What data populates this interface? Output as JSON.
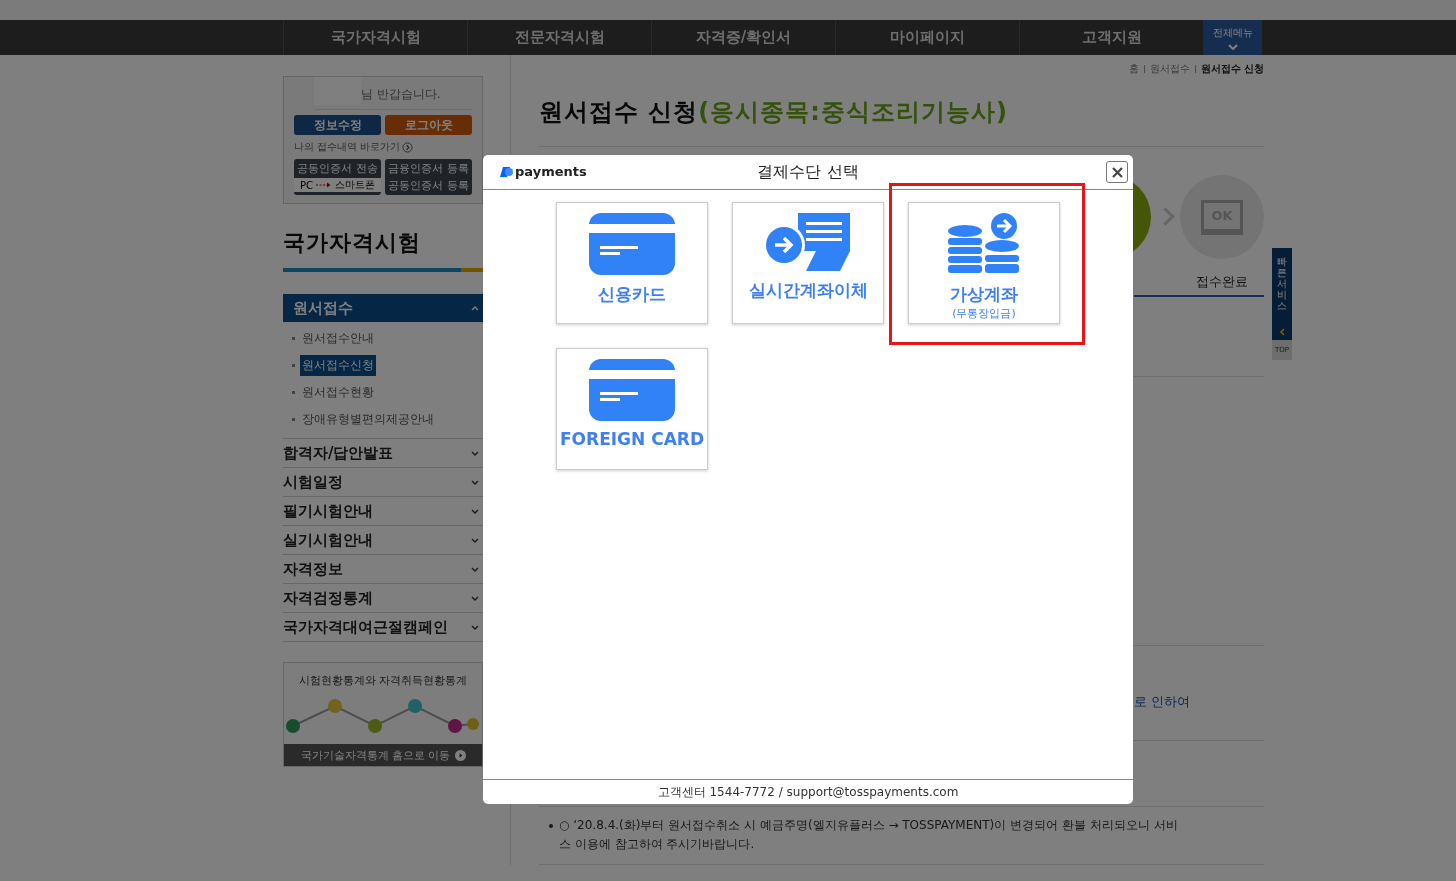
{
  "top_nav": {
    "items": [
      "국가자격시험",
      "전문자격시험",
      "자격증/확인서",
      "마이페이지",
      "고객지원"
    ],
    "all_menu": "전체메뉴"
  },
  "user_box": {
    "greeting": "님 반갑습니다.",
    "edit_button": "정보수정",
    "logout_button": "로그아웃",
    "my_link": "나의 접수내역 바로가기",
    "cert_send": {
      "title": "공동인증서 전송",
      "from": "PC",
      "to": "스마트폰"
    },
    "cert_register": [
      "금융인증서 등록",
      "공동인증서 등록"
    ]
  },
  "sidebar": {
    "title": "국가자격시험",
    "sections": [
      {
        "label": "원서접수",
        "expanded": true,
        "children": [
          {
            "label": "원서접수안내",
            "selected": false
          },
          {
            "label": "원서접수신청",
            "selected": true
          },
          {
            "label": "원서접수현황",
            "selected": false
          },
          {
            "label": "장애유형별편의제공안내",
            "selected": false
          }
        ]
      },
      {
        "label": "합격자/답안발표",
        "expanded": false
      },
      {
        "label": "시험일정",
        "expanded": false
      },
      {
        "label": "필기시험안내",
        "expanded": false
      },
      {
        "label": "실기시험안내",
        "expanded": false
      },
      {
        "label": "자격정보",
        "expanded": false
      },
      {
        "label": "자격검정통계",
        "expanded": false
      },
      {
        "label": "국가자격대여근절캠페인",
        "expanded": false
      }
    ]
  },
  "stats_banner": {
    "title": "시험현황통계와 자격취득현황통계",
    "link": "국가기술자격통계 홈으로 이동"
  },
  "breadcrumb": [
    "홈",
    "원서접수",
    "원서접수 신청"
  ],
  "page_title": {
    "text": "원서접수 신청",
    "subject": "(응시종목:중식조리기능사)"
  },
  "steps": [
    {
      "kind": "current"
    },
    {
      "kind": "done",
      "label": "접수완료",
      "icon_text": "OK"
    }
  ],
  "notice_fragment": "로 인하여",
  "notice": "○ ‘20.8.4.(화)부터 원서접수취소 시 예금주명(엘지유플러스 → TOSSPAYMENT)이 변경되어 환불 처리되오니 서비스 이용에 참고하여 주시기바랍니다.",
  "quick_service": {
    "label": "빠른서비스",
    "top": "TOP"
  },
  "modal": {
    "brand": "payments",
    "title": "결제수단 선택",
    "methods": [
      {
        "kind": "card",
        "label": "신용카드",
        "highlighted": false
      },
      {
        "kind": "transfer",
        "label": "실시간계좌이체",
        "highlighted": false
      },
      {
        "kind": "virtual",
        "label": "가상계좌",
        "sublabel": "(무통장입금)",
        "highlighted": true
      },
      {
        "kind": "card",
        "label": "FOREIGN CARD",
        "highlighted": false
      }
    ],
    "footer": "고객센터 1544-7772 / support@tosspayments.com"
  }
}
